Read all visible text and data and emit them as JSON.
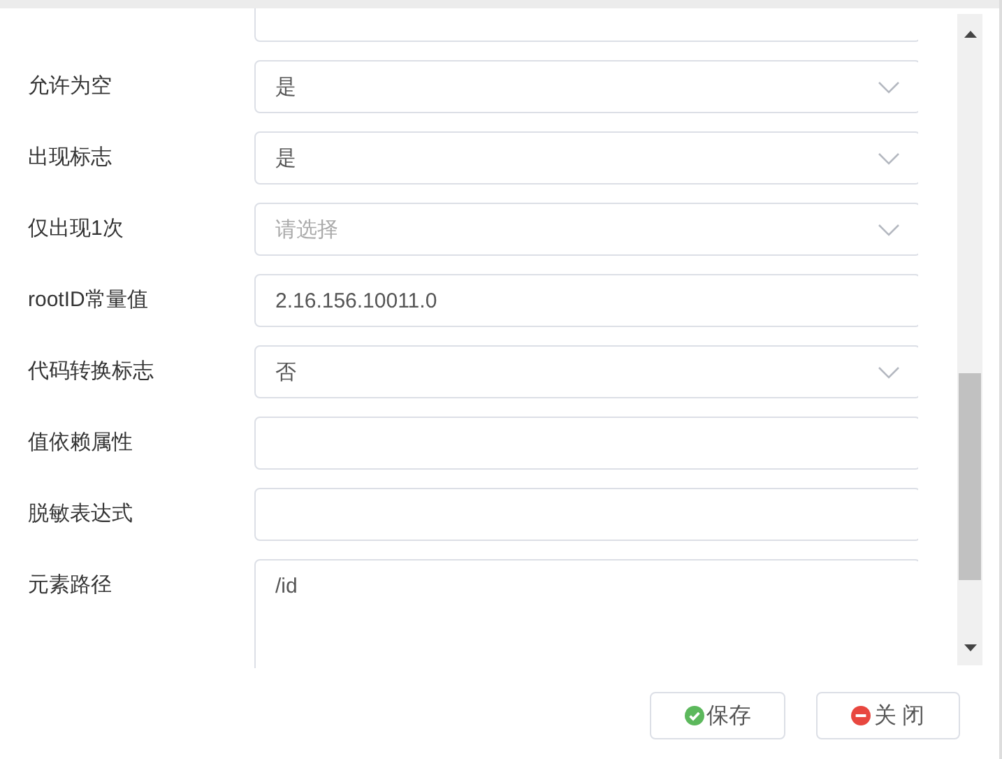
{
  "fields": [
    {
      "kind": "input"
    },
    {
      "kind": "select",
      "label": "允许为空",
      "value": "是"
    },
    {
      "kind": "select",
      "label": "出现标志",
      "value": "是"
    },
    {
      "kind": "select",
      "label": "仅出现1次",
      "placeholder": "请选择"
    },
    {
      "kind": "input",
      "label": "rootID常量值",
      "value": "2.16.156.10011.0"
    },
    {
      "kind": "select",
      "label": "代码转换标志",
      "value": "否"
    },
    {
      "kind": "input",
      "label": "值依赖属性"
    },
    {
      "kind": "input",
      "label": "脱敏表达式"
    },
    {
      "kind": "textarea",
      "label": "元素路径",
      "value": "/id"
    }
  ],
  "buttons": [
    {
      "kind": "save",
      "label": "保存"
    },
    {
      "kind": "close",
      "label": "关 闭"
    }
  ]
}
